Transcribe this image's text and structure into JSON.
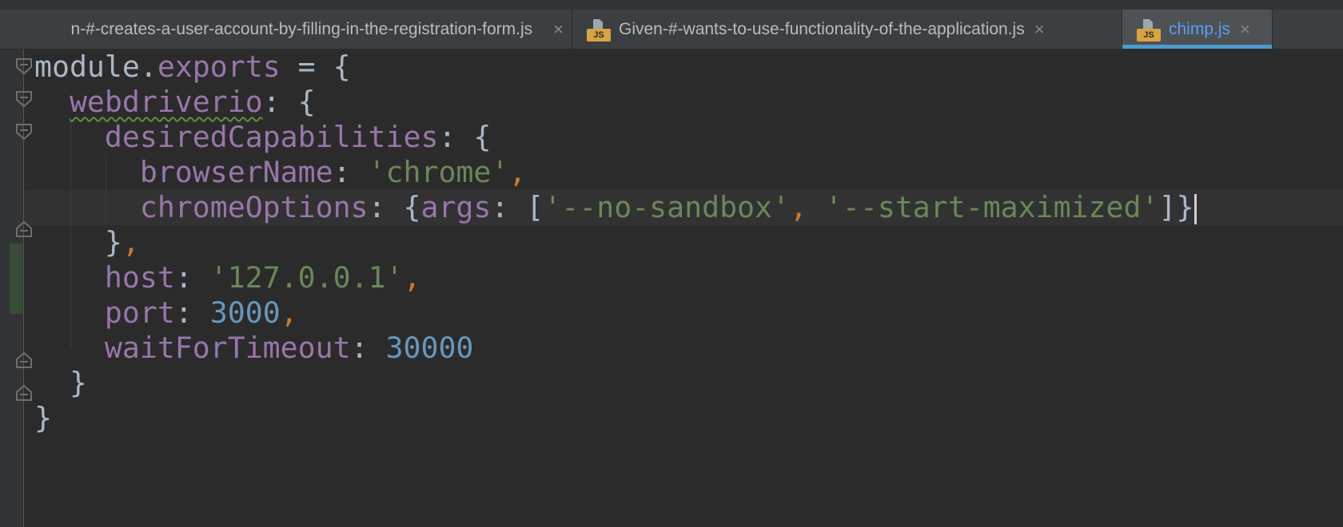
{
  "tabs": [
    {
      "label": "n-#-creates-a-user-account-by-filling-in-the-registration-form.js",
      "icon": "",
      "active": false
    },
    {
      "label": "Given-#-wants-to-use-functionality-of-the-application.js",
      "icon": "js-file-icon",
      "icon_badge": "JS",
      "active": false
    },
    {
      "label": "chimp.js",
      "icon": "js-file-icon",
      "icon_badge": "JS",
      "active": true
    }
  ],
  "close_glyph": "×",
  "code": {
    "l1": {
      "a": "module",
      "b": ".",
      "c": "exports",
      "d": " = {"
    },
    "l2": {
      "a": "webdriverio",
      "b": ": {"
    },
    "l3": {
      "a": "desiredCapabilities",
      "b": ": {"
    },
    "l4": {
      "a": "browserName",
      "b": ": ",
      "c": "'chrome'",
      "d": ","
    },
    "l5": {
      "a": "chromeOptions",
      "b": ": {",
      "c": "args",
      "d": ": [",
      "e": "'--no-sandbox'",
      "f": ", ",
      "g": "'--start-maximized'",
      "h": "]}"
    },
    "l6": {
      "a": "}",
      "b": ","
    },
    "l7": {
      "a": "host",
      "b": ": ",
      "c": "'127.0.0.1'",
      "d": ","
    },
    "l8": {
      "a": "port",
      "b": ": ",
      "c": "3000",
      "d": ","
    },
    "l9": {
      "a": "waitForTimeout",
      "b": ": ",
      "c": "30000"
    },
    "l10": {
      "a": "}"
    },
    "l11": {
      "a": "}"
    }
  },
  "colors": {
    "background": "#2b2b2b",
    "property": "#9876aa",
    "string": "#6a8759",
    "number": "#6897bb",
    "punctuation": "#cc7832",
    "plain": "#a9b7c6",
    "active_tab_text": "#589df6",
    "active_tab_underline": "#4a9bd1",
    "js_badge": "#d9a343"
  }
}
